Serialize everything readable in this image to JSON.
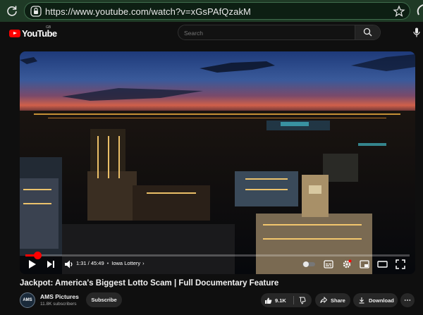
{
  "browser": {
    "url": "https://www.youtube.com/watch?v=xGsPAfQzakM",
    "icons": [
      "reload-icon",
      "lock-icon",
      "star-icon"
    ]
  },
  "header": {
    "logo_text": "YouTube",
    "region": "GB",
    "search_placeholder": "Search",
    "brand_color": "#ff0000"
  },
  "player": {
    "current_time": "1:31",
    "duration": "45:49",
    "time_display": "1:31 / 45:49",
    "chapter": "Iowa Lottery",
    "progress_fraction": 0.033,
    "controls": [
      "play-icon",
      "next-icon",
      "volume-icon",
      "autoplay-toggle",
      "subtitles-icon",
      "settings-icon",
      "miniplayer-icon",
      "theater-icon",
      "fullscreen-icon"
    ]
  },
  "video": {
    "title": "Jackpot: America's Biggest Lotto Scam | Full Documentary Feature"
  },
  "channel": {
    "avatar_text": "AMS",
    "name": "AMS Pictures",
    "subscribers": "11.8K subscribers",
    "subscribe_label": "Subscribe"
  },
  "actions": {
    "likes": "9.1K",
    "share_label": "Share",
    "download_label": "Download",
    "more_label": "⋯"
  }
}
